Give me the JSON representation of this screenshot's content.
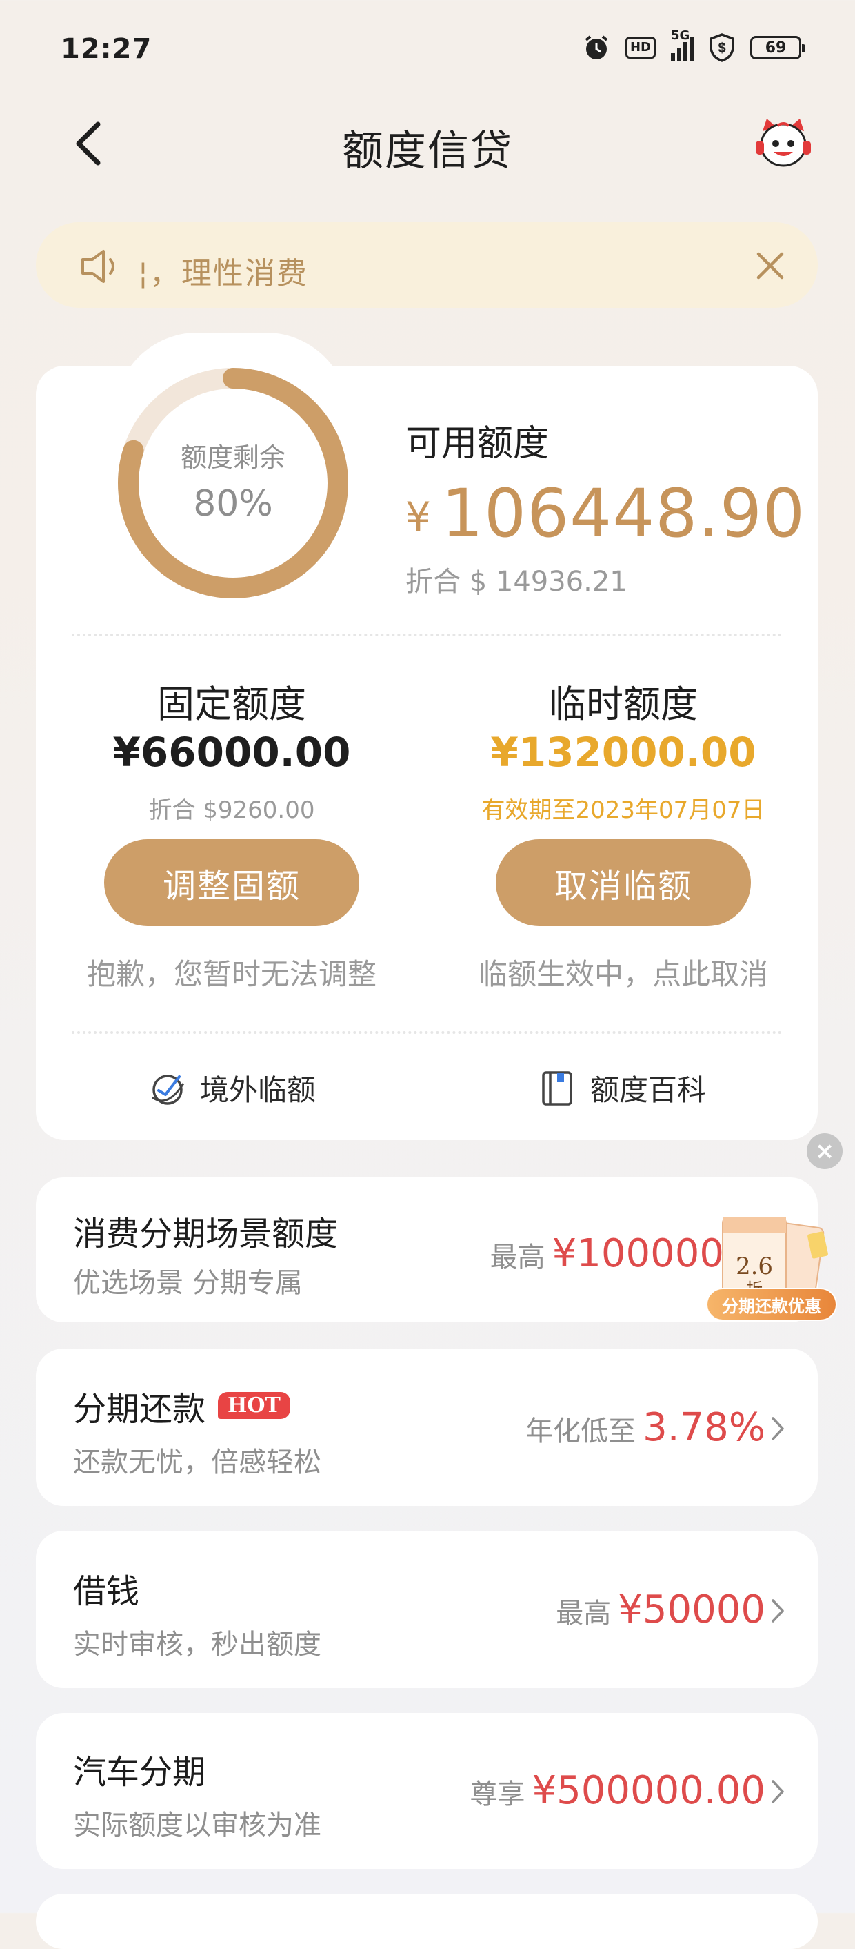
{
  "status_bar": {
    "time": "12:27",
    "hd_label": "HD",
    "network_label": "5G",
    "battery_level": "69"
  },
  "header": {
    "title": "额度信贷"
  },
  "notice": {
    "text": "¦，理性消费"
  },
  "credit": {
    "ring_label": "额度剩余",
    "ring_value": "80%",
    "ring_fraction": 0.8,
    "available_label": "可用额度",
    "available_currency": "¥",
    "available_amount": "106448.90",
    "available_converted": "折合 $ 14936.21"
  },
  "fixed": {
    "title": "固定额度",
    "value": "¥66000.00",
    "sub": "折合 $9260.00",
    "button_label": "调整固额",
    "note": "抱歉，您暂时无法调整"
  },
  "temporary": {
    "title": "临时额度",
    "value": "¥132000.00",
    "sub": "有效期至2023年07月07日",
    "button_label": "取消临额",
    "note": "临额生效中，点此取消"
  },
  "links": {
    "overseas": "境外临额",
    "encyclopedia": "额度百科"
  },
  "products": [
    {
      "title": "消费分期场景额度",
      "sub": "优选场景 分期专属",
      "prefix": "最高",
      "value": "¥100000"
    },
    {
      "title": "分期还款",
      "badge": "HOT",
      "sub": "还款无忧，倍感轻松",
      "prefix": "年化低至",
      "value": "3.78%"
    },
    {
      "title": "借钱",
      "sub": "实时审核，秒出额度",
      "prefix": "最高",
      "value": "¥50000"
    },
    {
      "title": "汽车分期",
      "sub": "实际额度以审核为准",
      "prefix": "尊享",
      "value": "¥500000.00"
    }
  ],
  "promo": {
    "discount": "2.6",
    "discount_unit": "折",
    "tag": "分期还款优惠"
  },
  "colors": {
    "accent": "#cd9e68",
    "gold_text": "#c7945a",
    "temp_gold": "#e8a82c",
    "highlight_red": "#de4b4b"
  }
}
